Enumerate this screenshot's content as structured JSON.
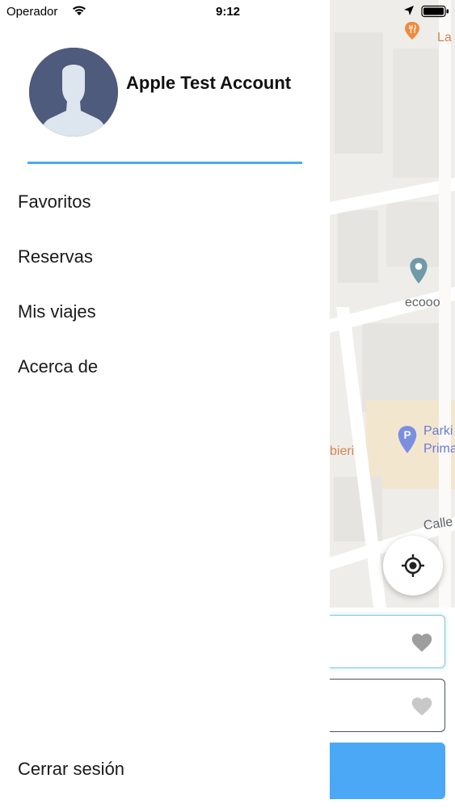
{
  "status_bar": {
    "carrier": "Operador",
    "time": "9:12"
  },
  "drawer": {
    "user_name": "Apple Test Account",
    "menu_items": [
      {
        "label": "Favoritos"
      },
      {
        "label": "Reservas"
      },
      {
        "label": "Mis viajes"
      },
      {
        "label": "Acerca de"
      }
    ],
    "logout_label": "Cerrar sesión"
  },
  "map": {
    "labels": {
      "restaurant": "La",
      "place": "ecooo",
      "parking_line1": "Parki",
      "parking_line2": "Prima",
      "street_fragment": "bieri",
      "street": "Calle"
    }
  },
  "colors": {
    "accent": "#4aa8f7",
    "avatar_bg": "#4f5b7c",
    "map_bg": "#f1efec"
  }
}
